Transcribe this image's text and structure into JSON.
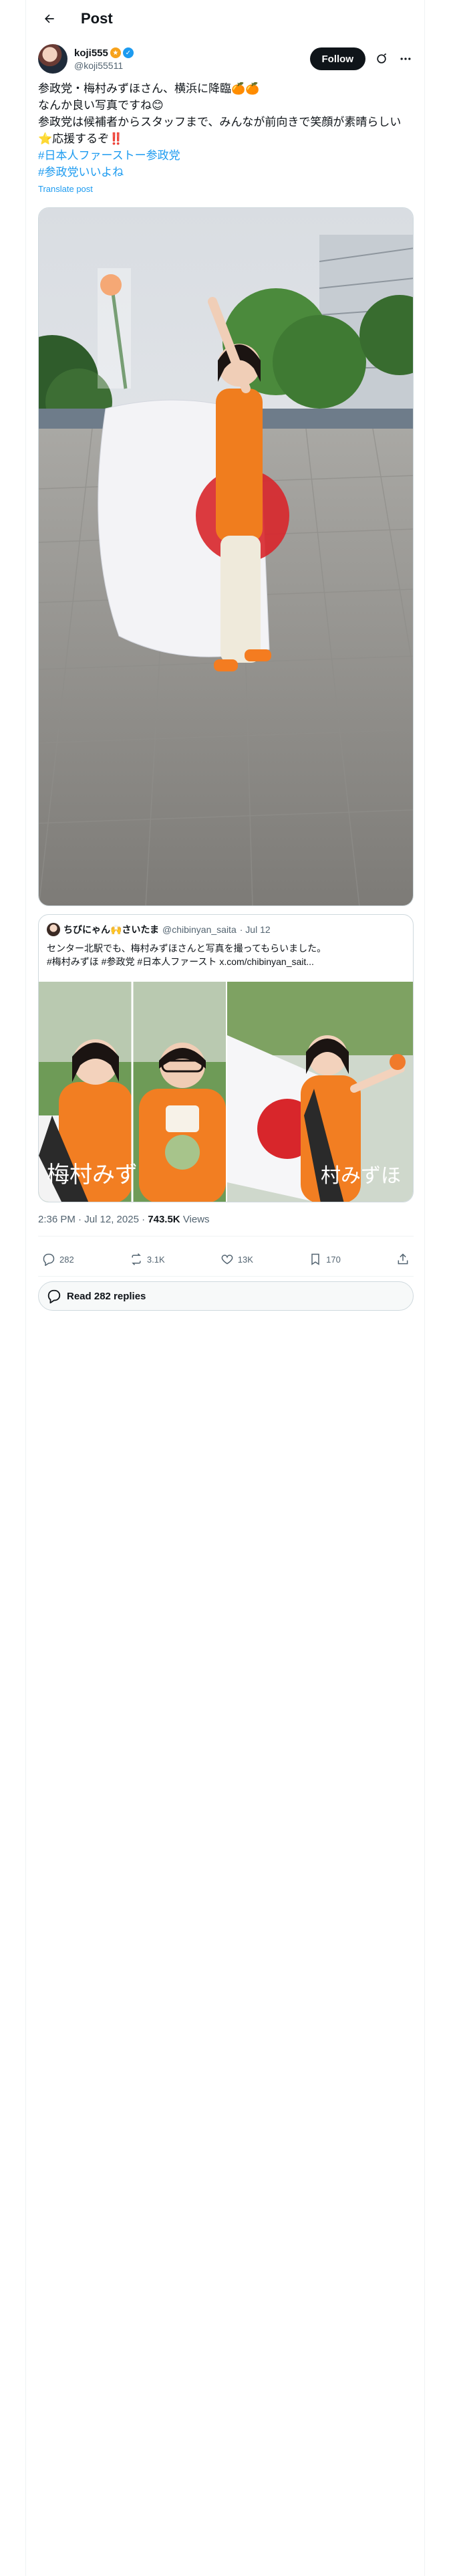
{
  "header": {
    "title": "Post"
  },
  "author": {
    "name": "koji555",
    "handle": "@koji55511",
    "follow_label": "Follow"
  },
  "post": {
    "lines": [
      "参政党・梅村みずほさん、横浜に降臨🍊🍊",
      "なんか良い写真ですね😊",
      "参政党は候補者からスタッフまで、みんなが前向きで笑顔が素晴らしい",
      "⭐応援するぞ‼️",
      "#日本人ファーストー参政党",
      "#参政党いいよね"
    ],
    "translate_label": "Translate post"
  },
  "quote": {
    "name": "ちびにゃん🙌さいたま",
    "handle": "@chibinyan_saita",
    "date": "· Jul 12",
    "lines": [
      "センター北駅でも、梅村みずほさんと写真を撮ってもらいました。",
      "#梅村みずほ #参政党 #日本人ファースト x.com/chibinyan_sait..."
    ],
    "poster_text_1": "梅村みずほ",
    "poster_text_2": "村みずほ"
  },
  "meta": {
    "time": "2:36 PM · Jul 12, 2025 ·",
    "views": "743.5K",
    "views_label": "Views"
  },
  "actions": {
    "replies": "282",
    "reposts": "3.1K",
    "likes": "13K",
    "bookmarks": "170"
  },
  "read_replies_label": "Read 282 replies",
  "colors": {
    "accent": "#1d9bf0",
    "orange": "#f7931e",
    "text": "#0f1419",
    "muted": "#536471"
  }
}
